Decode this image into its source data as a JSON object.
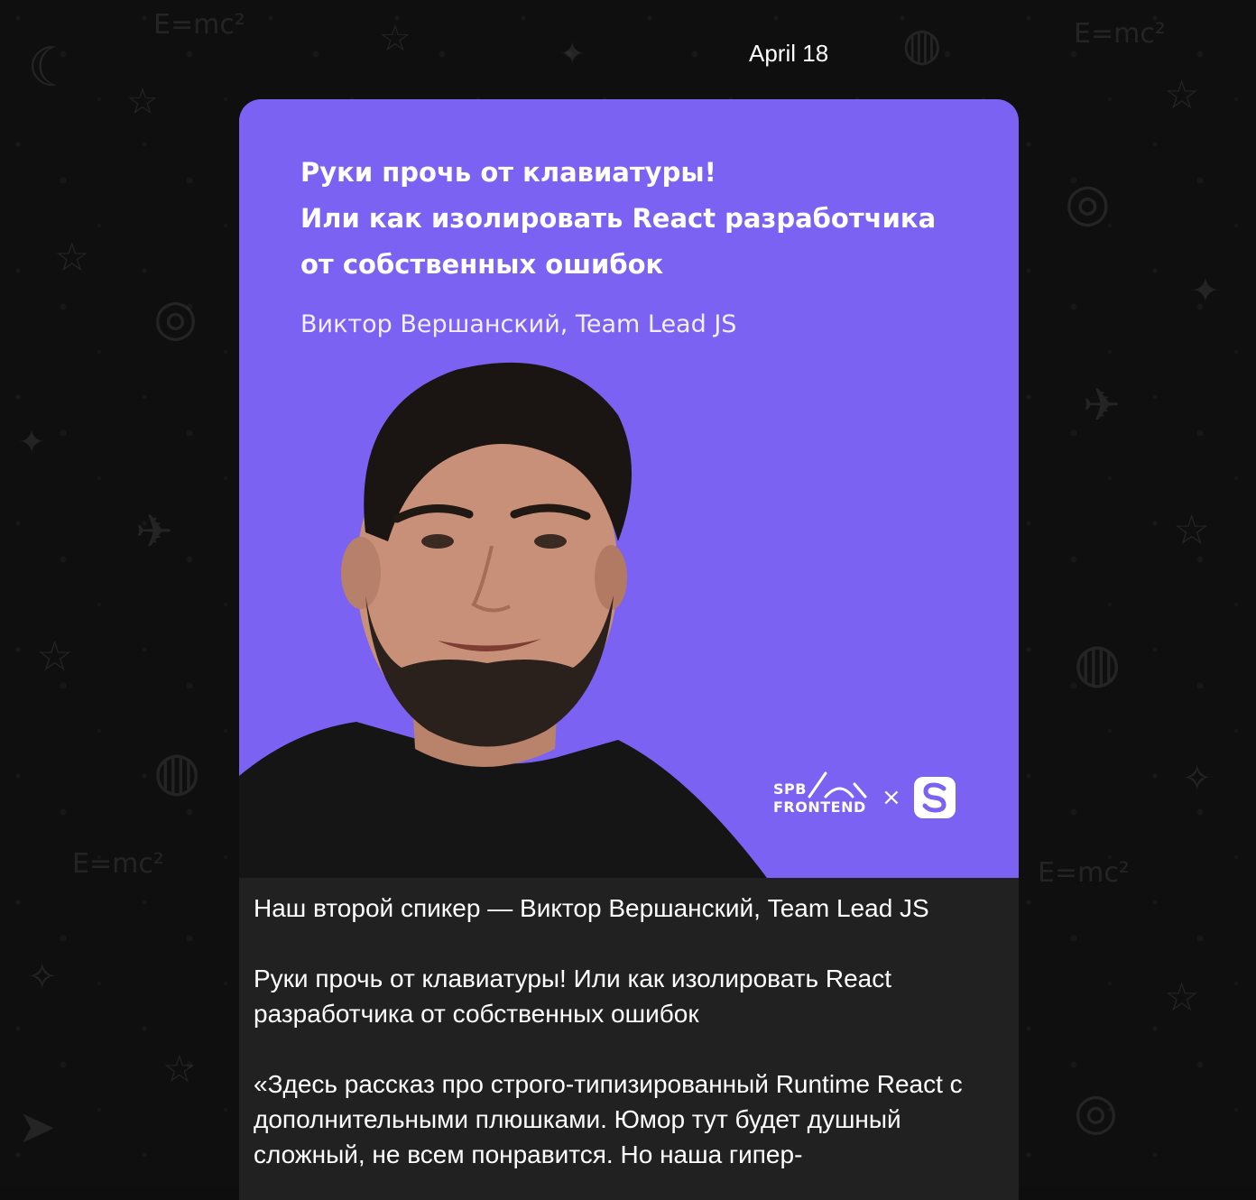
{
  "chat": {
    "date_label": "April 18"
  },
  "post": {
    "poster": {
      "title_lines": [
        "Руки прочь от клавиатуры!",
        "Или как изолировать React разработчика",
        "от собственных ошибок"
      ],
      "author": "Виктор Вершанский, Team Lead JS",
      "logo_left_line1": "SPB",
      "logo_left_line2": "FRONTEND",
      "logo_separator": "×",
      "logo_right_letter": "S",
      "background_color": "#7b62f2"
    },
    "caption": {
      "paragraph_1": "Наш второй спикер — Виктор Вершанский, Team Lead JS",
      "paragraph_2": "Руки прочь от клавиатуры! Или как изолировать React разработчика от собственных ошибок",
      "paragraph_3": "«Здесь рассказ про строго-типизированный Runtime React с дополнительными плюшками. Юмор тут будет душный сложный, не всем понравится. Но наша гипер-"
    }
  }
}
